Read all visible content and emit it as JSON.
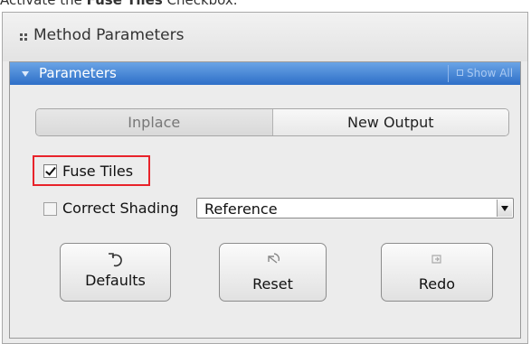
{
  "caption": {
    "prefix": "Activate the ",
    "bold": "Fuse Tiles",
    "suffix": " Checkbox."
  },
  "method_panel": {
    "title": "Method Parameters"
  },
  "parameters": {
    "title": "Parameters",
    "show_all": "Show All",
    "tabs": [
      {
        "label": "Inplace",
        "selected": false
      },
      {
        "label": "New Output",
        "selected": true
      }
    ],
    "fuse_tiles": {
      "label": "Fuse Tiles",
      "checked": true
    },
    "correct_shading": {
      "label": "Correct Shading",
      "checked": false
    },
    "shading_select": {
      "value": "Reference"
    },
    "buttons": {
      "defaults": "Defaults",
      "reset": "Reset",
      "redo": "Redo"
    }
  },
  "colors": {
    "header_blue": "#3b7ad6",
    "highlight_red": "#e8232a"
  },
  "icons": [
    "grip-icon",
    "collapse-triangle-icon",
    "show-all-icon",
    "checkmark-icon",
    "dropdown-arrow-icon",
    "undo-icon",
    "reset-icon",
    "redo-icon"
  ]
}
